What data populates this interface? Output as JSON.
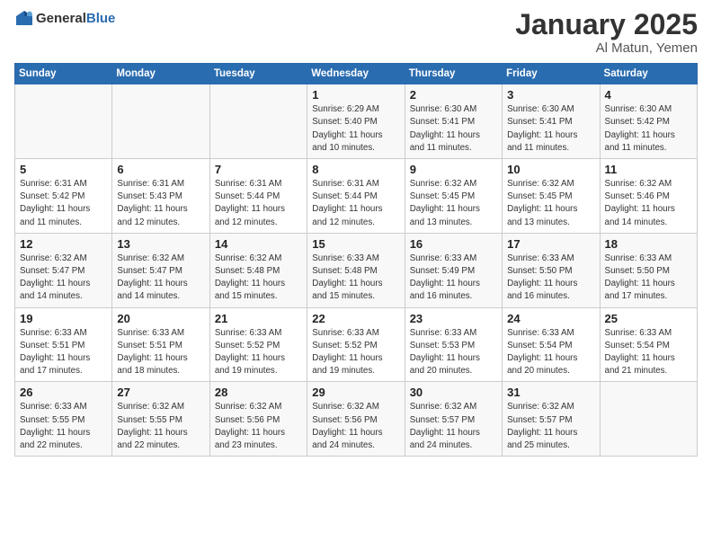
{
  "header": {
    "logo_general": "General",
    "logo_blue": "Blue",
    "month_year": "January 2025",
    "location": "Al Matun, Yemen"
  },
  "days_of_week": [
    "Sunday",
    "Monday",
    "Tuesday",
    "Wednesday",
    "Thursday",
    "Friday",
    "Saturday"
  ],
  "weeks": [
    [
      {
        "day": "",
        "info": ""
      },
      {
        "day": "",
        "info": ""
      },
      {
        "day": "",
        "info": ""
      },
      {
        "day": "1",
        "info": "Sunrise: 6:29 AM\nSunset: 5:40 PM\nDaylight: 11 hours\nand 10 minutes."
      },
      {
        "day": "2",
        "info": "Sunrise: 6:30 AM\nSunset: 5:41 PM\nDaylight: 11 hours\nand 11 minutes."
      },
      {
        "day": "3",
        "info": "Sunrise: 6:30 AM\nSunset: 5:41 PM\nDaylight: 11 hours\nand 11 minutes."
      },
      {
        "day": "4",
        "info": "Sunrise: 6:30 AM\nSunset: 5:42 PM\nDaylight: 11 hours\nand 11 minutes."
      }
    ],
    [
      {
        "day": "5",
        "info": "Sunrise: 6:31 AM\nSunset: 5:42 PM\nDaylight: 11 hours\nand 11 minutes."
      },
      {
        "day": "6",
        "info": "Sunrise: 6:31 AM\nSunset: 5:43 PM\nDaylight: 11 hours\nand 12 minutes."
      },
      {
        "day": "7",
        "info": "Sunrise: 6:31 AM\nSunset: 5:44 PM\nDaylight: 11 hours\nand 12 minutes."
      },
      {
        "day": "8",
        "info": "Sunrise: 6:31 AM\nSunset: 5:44 PM\nDaylight: 11 hours\nand 12 minutes."
      },
      {
        "day": "9",
        "info": "Sunrise: 6:32 AM\nSunset: 5:45 PM\nDaylight: 11 hours\nand 13 minutes."
      },
      {
        "day": "10",
        "info": "Sunrise: 6:32 AM\nSunset: 5:45 PM\nDaylight: 11 hours\nand 13 minutes."
      },
      {
        "day": "11",
        "info": "Sunrise: 6:32 AM\nSunset: 5:46 PM\nDaylight: 11 hours\nand 14 minutes."
      }
    ],
    [
      {
        "day": "12",
        "info": "Sunrise: 6:32 AM\nSunset: 5:47 PM\nDaylight: 11 hours\nand 14 minutes."
      },
      {
        "day": "13",
        "info": "Sunrise: 6:32 AM\nSunset: 5:47 PM\nDaylight: 11 hours\nand 14 minutes."
      },
      {
        "day": "14",
        "info": "Sunrise: 6:32 AM\nSunset: 5:48 PM\nDaylight: 11 hours\nand 15 minutes."
      },
      {
        "day": "15",
        "info": "Sunrise: 6:33 AM\nSunset: 5:48 PM\nDaylight: 11 hours\nand 15 minutes."
      },
      {
        "day": "16",
        "info": "Sunrise: 6:33 AM\nSunset: 5:49 PM\nDaylight: 11 hours\nand 16 minutes."
      },
      {
        "day": "17",
        "info": "Sunrise: 6:33 AM\nSunset: 5:50 PM\nDaylight: 11 hours\nand 16 minutes."
      },
      {
        "day": "18",
        "info": "Sunrise: 6:33 AM\nSunset: 5:50 PM\nDaylight: 11 hours\nand 17 minutes."
      }
    ],
    [
      {
        "day": "19",
        "info": "Sunrise: 6:33 AM\nSunset: 5:51 PM\nDaylight: 11 hours\nand 17 minutes."
      },
      {
        "day": "20",
        "info": "Sunrise: 6:33 AM\nSunset: 5:51 PM\nDaylight: 11 hours\nand 18 minutes."
      },
      {
        "day": "21",
        "info": "Sunrise: 6:33 AM\nSunset: 5:52 PM\nDaylight: 11 hours\nand 19 minutes."
      },
      {
        "day": "22",
        "info": "Sunrise: 6:33 AM\nSunset: 5:52 PM\nDaylight: 11 hours\nand 19 minutes."
      },
      {
        "day": "23",
        "info": "Sunrise: 6:33 AM\nSunset: 5:53 PM\nDaylight: 11 hours\nand 20 minutes."
      },
      {
        "day": "24",
        "info": "Sunrise: 6:33 AM\nSunset: 5:54 PM\nDaylight: 11 hours\nand 20 minutes."
      },
      {
        "day": "25",
        "info": "Sunrise: 6:33 AM\nSunset: 5:54 PM\nDaylight: 11 hours\nand 21 minutes."
      }
    ],
    [
      {
        "day": "26",
        "info": "Sunrise: 6:33 AM\nSunset: 5:55 PM\nDaylight: 11 hours\nand 22 minutes."
      },
      {
        "day": "27",
        "info": "Sunrise: 6:32 AM\nSunset: 5:55 PM\nDaylight: 11 hours\nand 22 minutes."
      },
      {
        "day": "28",
        "info": "Sunrise: 6:32 AM\nSunset: 5:56 PM\nDaylight: 11 hours\nand 23 minutes."
      },
      {
        "day": "29",
        "info": "Sunrise: 6:32 AM\nSunset: 5:56 PM\nDaylight: 11 hours\nand 24 minutes."
      },
      {
        "day": "30",
        "info": "Sunrise: 6:32 AM\nSunset: 5:57 PM\nDaylight: 11 hours\nand 24 minutes."
      },
      {
        "day": "31",
        "info": "Sunrise: 6:32 AM\nSunset: 5:57 PM\nDaylight: 11 hours\nand 25 minutes."
      },
      {
        "day": "",
        "info": ""
      }
    ]
  ]
}
